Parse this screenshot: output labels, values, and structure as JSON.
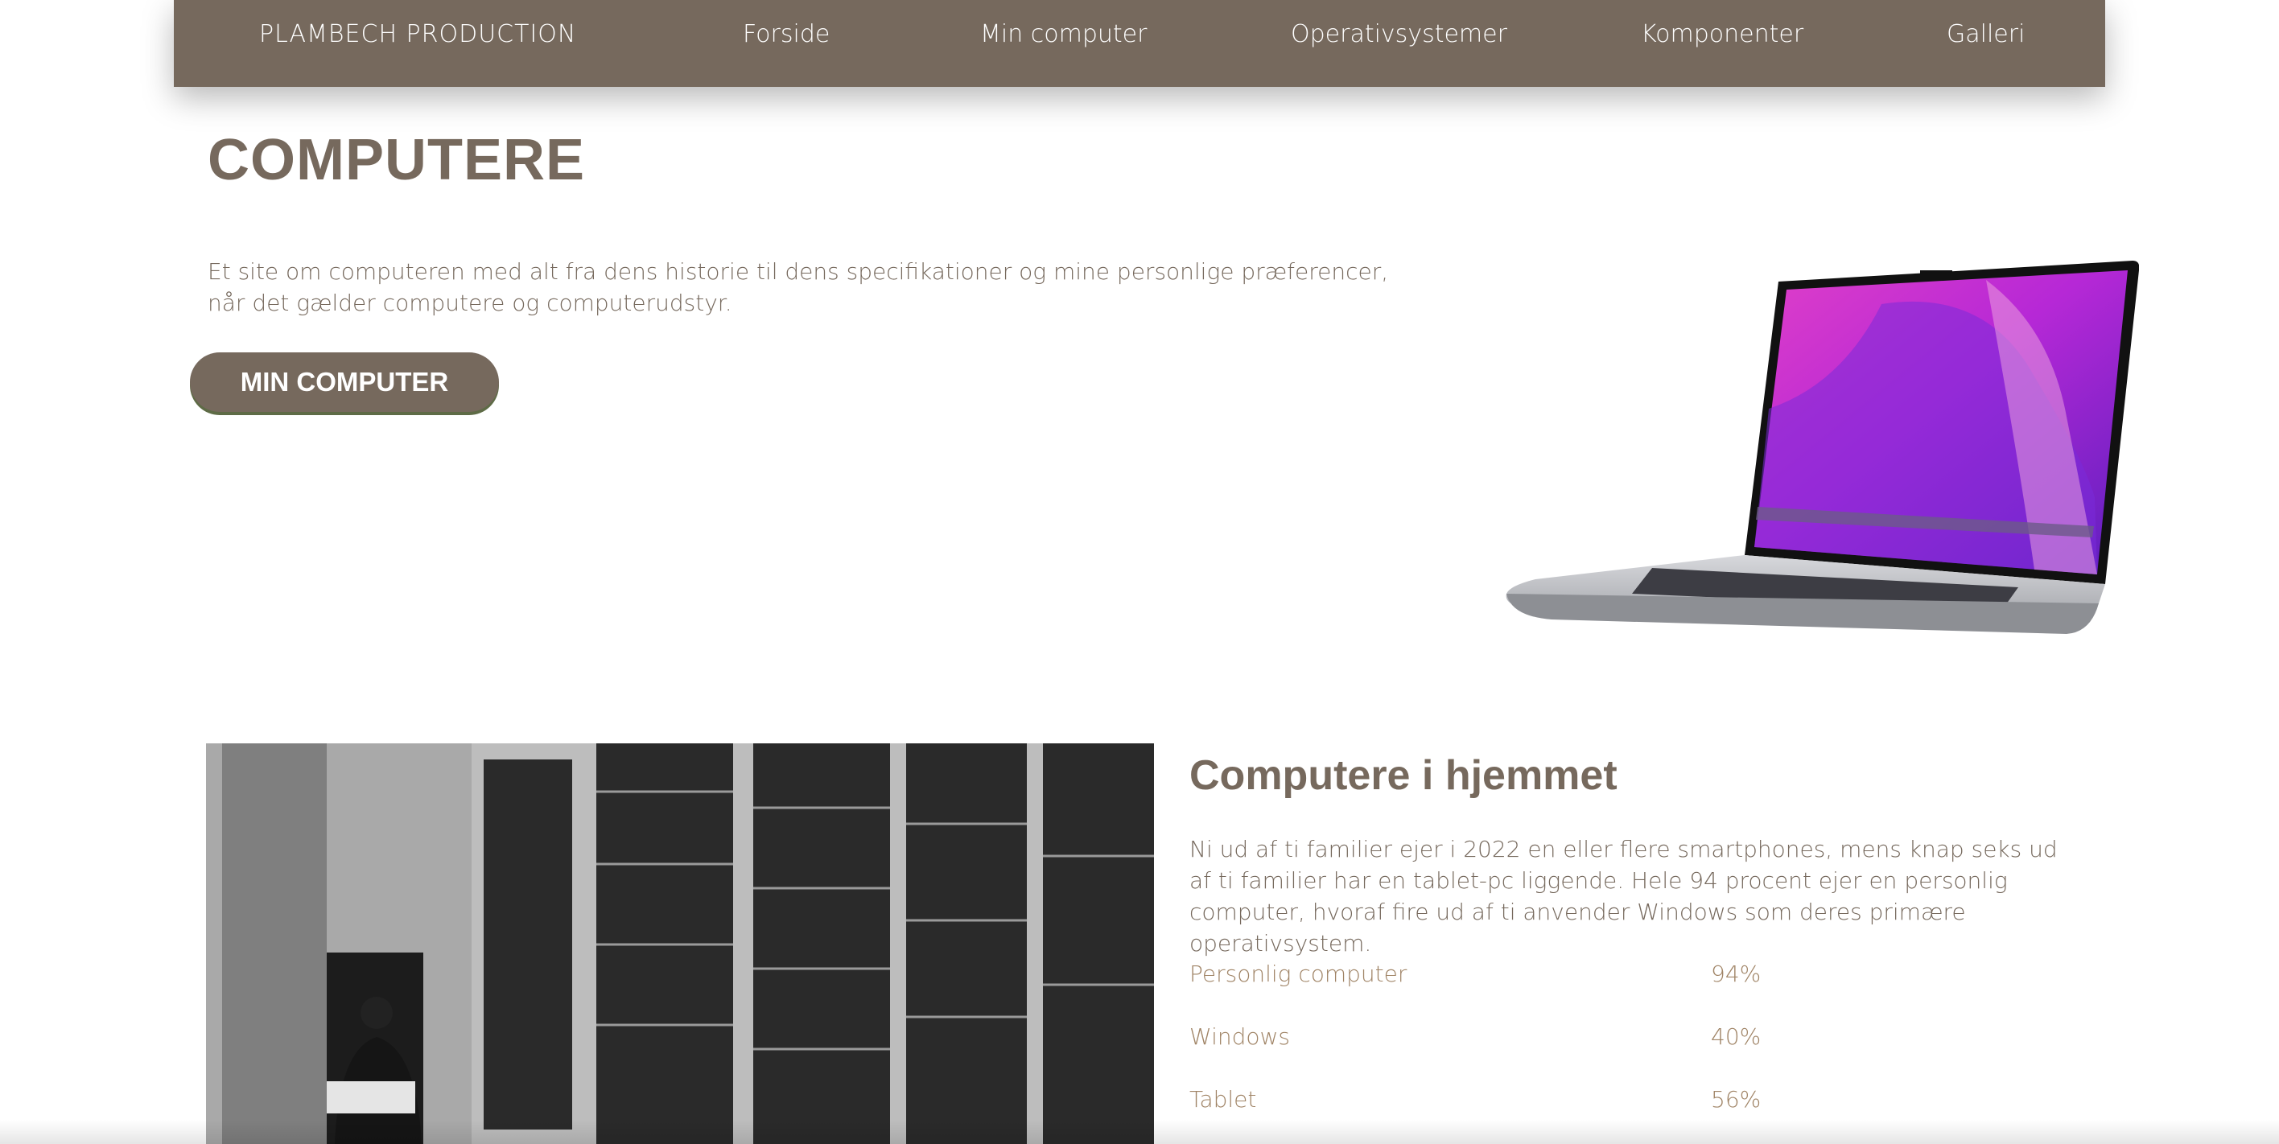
{
  "nav": {
    "brand": "PLAMBECH PRODUCTION",
    "items": [
      "Forside",
      "Min computer",
      "Operativsystemer",
      "Komponenter",
      "Galleri"
    ]
  },
  "hero": {
    "title": "COMPUTERE",
    "intro": "Et site om computeren med alt fra dens historie til dens specifikationer og mine personlige præferencer, når det gælder computere og computerudstyr.",
    "button_label": "MIN COMPUTER"
  },
  "section": {
    "title": "Computere i hjemmet",
    "text": "Ni ud af ti familier ejer i 2022 en eller flere smartphones, mens knap seks ud af ti familier har en tablet-pc liggende. Hele 94 procent ejer en personlig computer, hvoraf fire ud af ti anvender Windows som deres primære operativsystem.",
    "stats": [
      {
        "label": "Personlig computer",
        "value": "94%"
      },
      {
        "label": "Windows",
        "value": "40%"
      },
      {
        "label": "Tablet",
        "value": "56%"
      }
    ]
  },
  "colors": {
    "brand": "#76695d",
    "stat_text": "#a08466",
    "button_shadow": "#5e6b46"
  }
}
